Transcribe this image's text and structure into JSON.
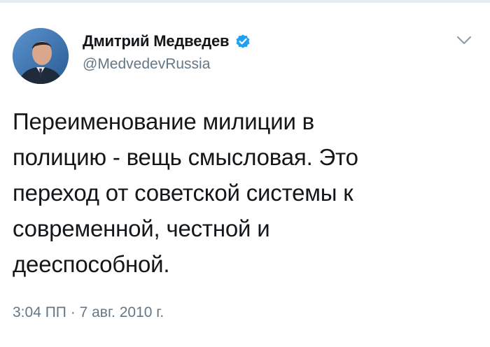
{
  "tweet": {
    "author": {
      "display_name": "Дмитрий Медведев",
      "handle": "@MedvedevRussia",
      "verified_icon": "verified-badge-icon",
      "avatar": "avatar"
    },
    "menu_icon": "chevron-down-icon",
    "text_lines": [
      "Переименование милиции в",
      "полицию - вещь смысловая. Это",
      "переход от советской системы к",
      "современной, честной и",
      "дееспособной."
    ],
    "time": "3:04 ПП",
    "separator": "·",
    "date": "7 авг. 2010 г."
  },
  "colors": {
    "verified": "#1da1f2",
    "secondary_text": "#657786",
    "primary_text": "#14171a"
  }
}
